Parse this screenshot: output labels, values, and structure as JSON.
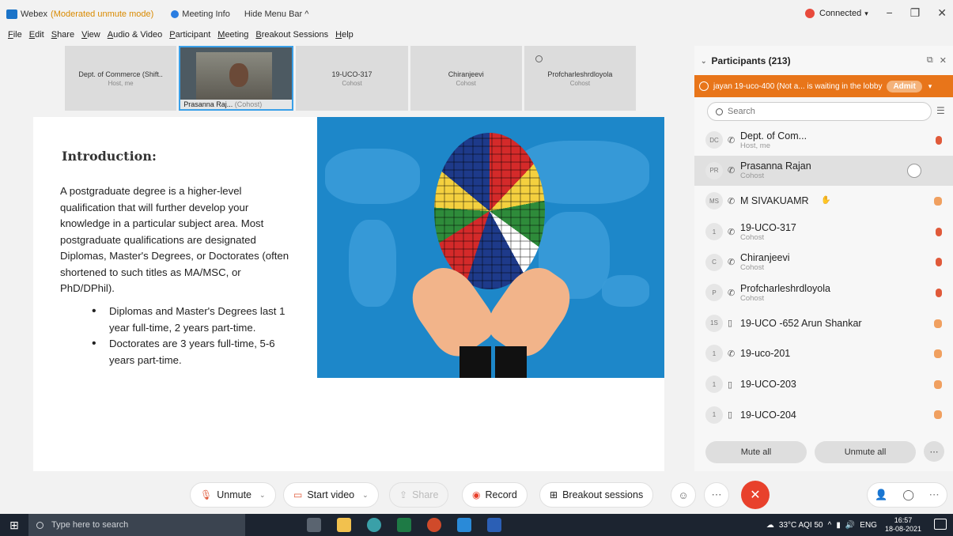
{
  "window": {
    "app_title": "Webex",
    "moderation": "(Moderated unmute mode)",
    "meeting_info": "Meeting Info",
    "hide_menu": "Hide Menu Bar ^",
    "status": "Connected",
    "status_caret": "▾"
  },
  "menu": [
    "File",
    "Edit",
    "Share",
    "View",
    "Audio & Video",
    "Participant",
    "Meeting",
    "Breakout Sessions",
    "Help"
  ],
  "video_tiles": [
    {
      "name": "Dept. of Commerce (Shift..",
      "role": "Host, me"
    },
    {
      "name": "Prasanna Raj...",
      "role": "(Cohost)",
      "active": true
    },
    {
      "name": "19-UCO-317",
      "role": "Cohost"
    },
    {
      "name": "Chiranjeevi",
      "role": "Cohost"
    },
    {
      "name": "Profcharleshrdloyola",
      "role": "Cohost"
    }
  ],
  "slide": {
    "heading": "Introduction:",
    "paragraph": "A postgraduate degree is a higher-level qualification that will further develop your knowledge in a particular subject area. Most postgraduate qualifications are designated Diplomas, Master's Degrees, or Doctorates (often shortened to such titles as  MA/MSC, or PhD/DPhil).",
    "bullets": [
      "Diplomas and Master's Degrees last 1 year full-time, 2 years part-time.",
      "Doctorates are 3 years full-time, 5-6 years part-time."
    ]
  },
  "panel": {
    "title": "Participants (213)",
    "lobby_text": "jayan 19-uco-400 (Not a... is waiting in the lobby",
    "admit_label": "Admit",
    "search_placeholder": "Search",
    "participants": [
      {
        "initials": "DC",
        "name": "Dept. of Com...",
        "role": "Host, me",
        "device": "phone"
      },
      {
        "initials": "PR",
        "name": "Prasanna Rajan",
        "role": "Cohost",
        "device": "phone",
        "selected": true
      },
      {
        "initials": "MS",
        "name": "M SIVAKUAMR",
        "role": "",
        "device": "phone"
      },
      {
        "initials": "1",
        "name": "19-UCO-317",
        "role": "Cohost",
        "device": "phone"
      },
      {
        "initials": "C",
        "name": "Chiranjeevi",
        "role": "Cohost",
        "device": "phone"
      },
      {
        "initials": "P",
        "name": "Profcharleshrdloyola",
        "role": "Cohost",
        "device": "phone"
      },
      {
        "initials": "1S",
        "name": "19-UCO -652 Arun Shankar",
        "role": "",
        "device": "mobile"
      },
      {
        "initials": "1",
        "name": "19-uco-201",
        "role": "",
        "device": "phone"
      },
      {
        "initials": "1",
        "name": "19-UCO-203",
        "role": "",
        "device": "mobile"
      },
      {
        "initials": "1",
        "name": "19-UCO-204",
        "role": "",
        "device": "mobile"
      }
    ],
    "mute_all": "Mute all",
    "unmute_all": "Unmute all"
  },
  "controls": {
    "unmute": "Unmute",
    "start_video": "Start video",
    "share": "Share",
    "record": "Record",
    "breakout": "Breakout sessions"
  },
  "taskbar": {
    "search_placeholder": "Type here to search",
    "weather": "33°C  AQI 50",
    "lang": "ENG",
    "time": "16:57",
    "date": "18-08-2021"
  },
  "colors": {
    "accent": "#2a7de1",
    "lobby": "#e8751a",
    "end_call": "#e8412c",
    "slide_bg": "#1d87c9"
  }
}
